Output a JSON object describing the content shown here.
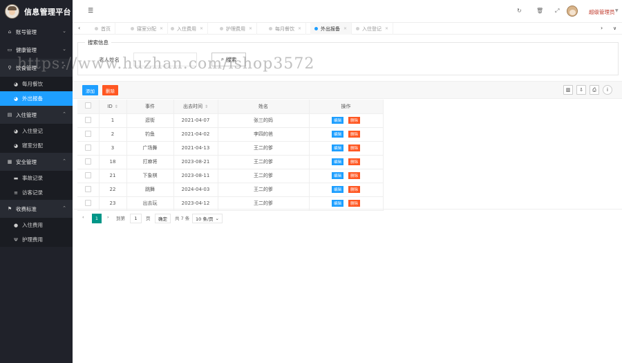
{
  "app": {
    "title": "信息管理平台"
  },
  "sidebar": {
    "groups": [
      {
        "label": "账号管理",
        "icon": "home-icon",
        "open": false,
        "items": []
      },
      {
        "label": "健康管理",
        "icon": "monitor-icon",
        "open": false,
        "items": []
      },
      {
        "label": "饮食管理",
        "icon": "share-icon",
        "open": true,
        "items": [
          {
            "label": "每月餐饮",
            "icon": "dashboard-icon",
            "active": false
          },
          {
            "label": "外出报备",
            "icon": "dashboard-icon",
            "active": true
          }
        ]
      },
      {
        "label": "入住管理",
        "icon": "file-icon",
        "open": true,
        "items": [
          {
            "label": "入住登记",
            "icon": "dashboard-icon",
            "active": false
          },
          {
            "label": "寝室分配",
            "icon": "dashboard-icon",
            "active": false
          }
        ]
      },
      {
        "label": "安全管理",
        "icon": "calendar-icon",
        "open": true,
        "items": [
          {
            "label": "事故记录",
            "icon": "list-icon",
            "active": false
          },
          {
            "label": "访客记录",
            "icon": "menu-icon",
            "active": false
          }
        ]
      },
      {
        "label": "收费标准",
        "icon": "flag-icon",
        "open": true,
        "items": [
          {
            "label": "入住费用",
            "icon": "circle-icon",
            "active": false
          },
          {
            "label": "护理费用",
            "icon": "fork-icon",
            "active": false
          }
        ]
      }
    ]
  },
  "header": {
    "user_name": "超级管理员",
    "tools": [
      "refresh-icon",
      "trash-icon",
      "fullscreen-icon"
    ]
  },
  "tabs": [
    {
      "label": "首页",
      "closable": false,
      "active": false
    },
    {
      "label": "寝室分配",
      "closable": true,
      "active": false
    },
    {
      "label": "入住费用",
      "closable": true,
      "active": false
    },
    {
      "label": "护理费用",
      "closable": true,
      "active": false
    },
    {
      "label": "每月餐饮",
      "closable": true,
      "active": false
    },
    {
      "label": "外出报备",
      "closable": true,
      "active": true
    },
    {
      "label": "入住登记",
      "closable": true,
      "active": false
    }
  ],
  "search": {
    "legend": "搜索信息",
    "label": "老人姓名",
    "value": "",
    "button": "搜索"
  },
  "toolbar": {
    "add": "添加",
    "delete": "删除"
  },
  "table": {
    "columns": [
      "ID",
      "事件",
      "出去时间",
      "姓名",
      "操作"
    ],
    "edit_label": "编辑",
    "delete_label": "删除",
    "rows": [
      {
        "id": "1",
        "event": "逛街",
        "time": "2021-04-07",
        "name": "张三的妈"
      },
      {
        "id": "2",
        "event": "钓鱼",
        "time": "2021-04-02",
        "name": "李四的爸"
      },
      {
        "id": "3",
        "event": "广场舞",
        "time": "2021-04-13",
        "name": "王二的爹"
      },
      {
        "id": "18",
        "event": "打麻将",
        "time": "2023-08-21",
        "name": "王二的爹"
      },
      {
        "id": "21",
        "event": "下象棋",
        "time": "2023-08-11",
        "name": "王二的爹"
      },
      {
        "id": "22",
        "event": "跳舞",
        "time": "2024-04-03",
        "name": "王二的爹"
      },
      {
        "id": "23",
        "event": "出去玩",
        "time": "2023-04-12",
        "name": "王二的爹"
      }
    ]
  },
  "pager": {
    "current": "1",
    "goto_prefix": "到第",
    "goto_value": "1",
    "goto_suffix": "页",
    "confirm": "确定",
    "total": "共 7 条",
    "page_size": "10 条/页"
  },
  "watermark": "https://www.huzhan.com/ishop3572"
}
